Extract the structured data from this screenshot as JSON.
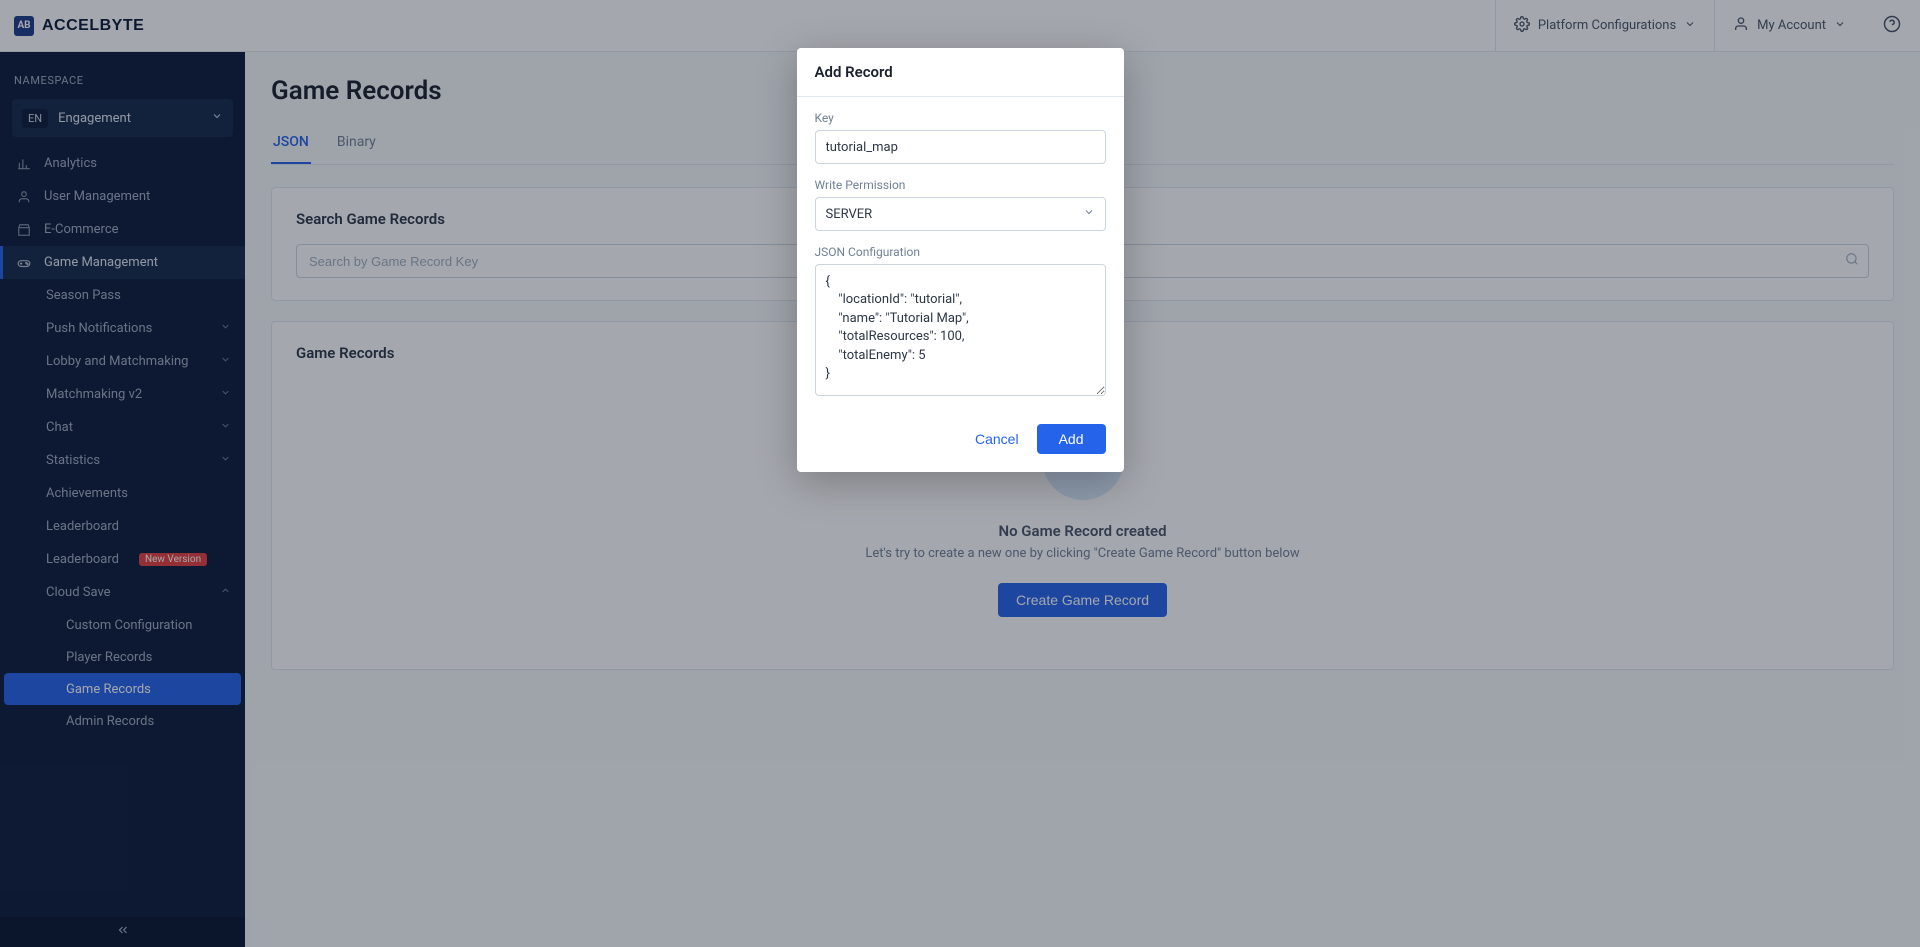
{
  "brand": {
    "mark": "AB",
    "name": "ACCELBYTE"
  },
  "topbar": {
    "platform_config": "Platform Configurations",
    "my_account": "My Account"
  },
  "sidebar": {
    "namespace_label": "NAMESPACE",
    "namespace_code": "EN",
    "namespace_name": "Engagement",
    "items": {
      "analytics": "Analytics",
      "user_management": "User Management",
      "ecommerce": "E-Commerce",
      "game_management": "Game Management"
    },
    "gm": {
      "season_pass": "Season Pass",
      "push_notifications": "Push Notifications",
      "lobby": "Lobby and Matchmaking",
      "matchmaking_v2": "Matchmaking v2",
      "chat": "Chat",
      "statistics": "Statistics",
      "achievements": "Achievements",
      "leaderboard": "Leaderboard",
      "leaderboard_new": "Leaderboard",
      "leaderboard_badge": "New Version",
      "cloud_save": "Cloud Save",
      "cs_custom_config": "Custom Configuration",
      "cs_player_records": "Player Records",
      "cs_game_records": "Game Records",
      "cs_admin_records": "Admin Records"
    }
  },
  "main": {
    "title": "Game Records",
    "tabs": {
      "json": "JSON",
      "binary": "Binary"
    },
    "search_heading": "Search Game Records",
    "search_placeholder": "Search by Game Record Key",
    "list_heading": "Game Records",
    "empty_title": "No Game Record created",
    "empty_sub": "Let's try to create a new one by clicking \"Create Game Record\" button below",
    "create_button": "Create Game Record"
  },
  "modal": {
    "title": "Add Record",
    "key_label": "Key",
    "key_value": "tutorial_map",
    "perm_label": "Write Permission",
    "perm_value": "SERVER",
    "json_label": "JSON Configuration",
    "json_value": "{\n    \"locationId\": \"tutorial\",\n    \"name\": \"Tutorial Map\",\n    \"totalResources\": 100,\n    \"totalEnemy\": 5\n}",
    "cancel": "Cancel",
    "add": "Add"
  }
}
